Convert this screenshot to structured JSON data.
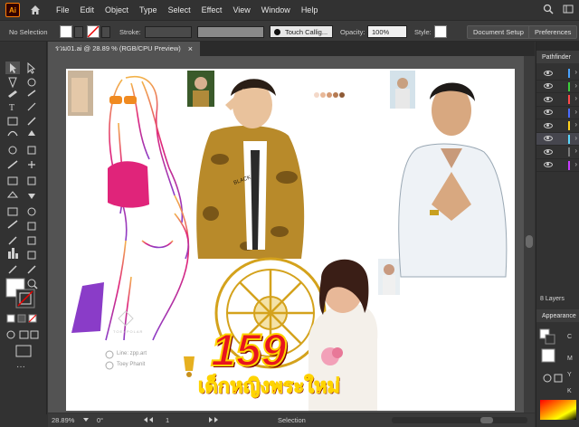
{
  "app": {
    "logo": "Ai",
    "menus": [
      "File",
      "Edit",
      "Object",
      "Type",
      "Select",
      "Effect",
      "View",
      "Window",
      "Help"
    ]
  },
  "control": {
    "selection": "No Selection",
    "stroke_label": "Stroke:",
    "brush": "Touch Callig...",
    "opacity_label": "Opacity:",
    "opacity": "100%",
    "style_label": "Style:",
    "doc_setup": "Document Setup",
    "preferences": "Preferences"
  },
  "document": {
    "tab_title": "รวม01.ai @ 28.89 % (RGB/CPU Preview)",
    "close": "×"
  },
  "artwork": {
    "number": "159",
    "title": "เด็กหญิงพระใหม่",
    "line_contact": "Line: zpp.art",
    "name_contact": "Toey Phanit",
    "watermark": "TOEYPOLAR"
  },
  "status": {
    "zoom": "28.89%",
    "rotation": "0°",
    "artboard": "1",
    "mode": "Selection"
  },
  "panels": {
    "pathfinder": "Pathfinder",
    "layers_count": "8 Layers",
    "appearance": "Appearance"
  },
  "layer_colors": [
    "#4aa3ff",
    "#3ccf3c",
    "#ff4a4a",
    "#4a6cff",
    "#ffd21e",
    "#5ad9ff",
    "#7a7a7a",
    "#c83cff"
  ],
  "palette": [
    "#f3d8c8",
    "#e8b898",
    "#d49a74",
    "#b67a52",
    "#8e5a36"
  ],
  "colors": {
    "pink": "#e0247a",
    "purple": "#8a3cc8",
    "gold": "#d4a21c",
    "red": "#e8141e",
    "yellow": "#ffd400"
  }
}
